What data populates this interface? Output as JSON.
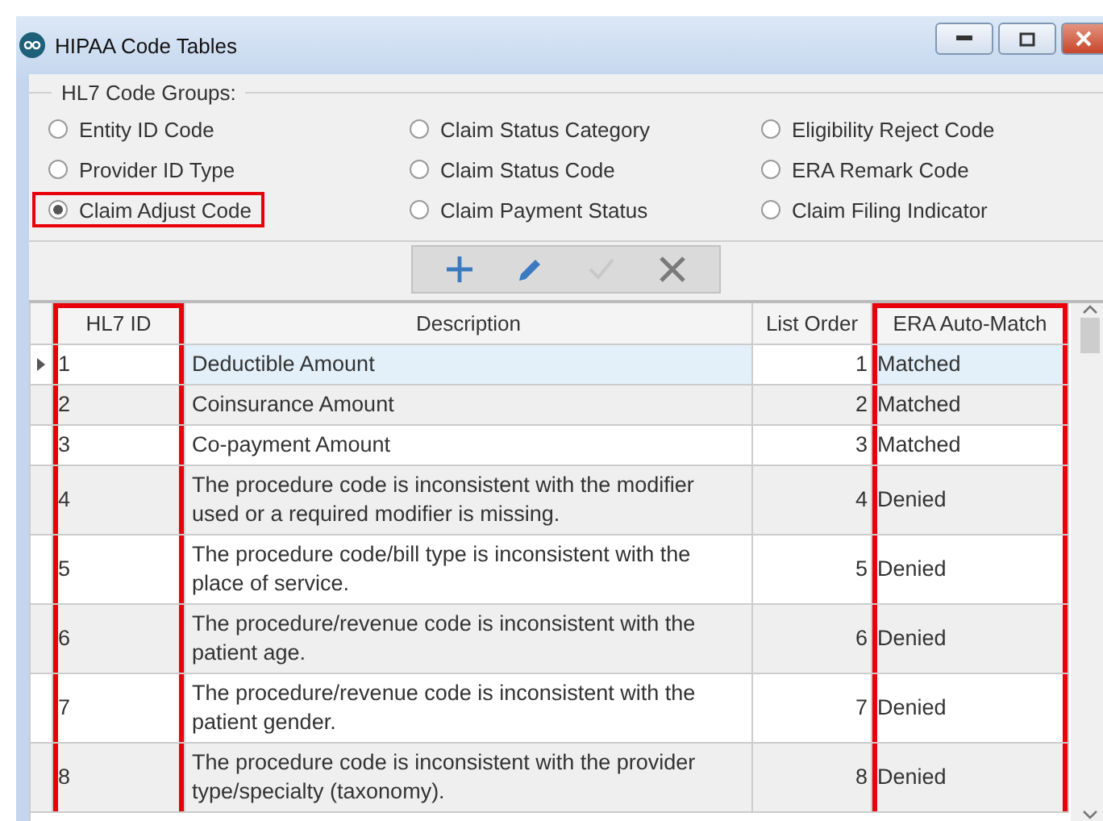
{
  "window": {
    "title": "HIPAA Code Tables"
  },
  "code_groups": {
    "title": "HL7 Code Groups:",
    "options": [
      {
        "label": "Entity ID Code",
        "selected": false,
        "highlighted": false
      },
      {
        "label": "Claim Status Category",
        "selected": false,
        "highlighted": false
      },
      {
        "label": "Eligibility Reject Code",
        "selected": false,
        "highlighted": false
      },
      {
        "label": "Provider ID Type",
        "selected": false,
        "highlighted": false
      },
      {
        "label": "Claim Status Code",
        "selected": false,
        "highlighted": false
      },
      {
        "label": "ERA Remark Code",
        "selected": false,
        "highlighted": false
      },
      {
        "label": "Claim Adjust Code",
        "selected": true,
        "highlighted": true
      },
      {
        "label": "Claim Payment Status",
        "selected": false,
        "highlighted": false
      },
      {
        "label": "Claim Filing Indicator",
        "selected": false,
        "highlighted": false
      }
    ]
  },
  "toolbar": [
    {
      "kind": "add",
      "disabled": false
    },
    {
      "kind": "edit",
      "disabled": false
    },
    {
      "kind": "confirm",
      "disabled": true
    },
    {
      "kind": "delete",
      "disabled": false
    }
  ],
  "table": {
    "columns": [
      {
        "label": "HL7 ID",
        "highlighted": true
      },
      {
        "label": "Description",
        "highlighted": false
      },
      {
        "label": "List Order",
        "highlighted": false
      },
      {
        "label": "ERA Auto-Match",
        "highlighted": true
      }
    ],
    "rows": [
      {
        "selected": true,
        "cells": [
          "1",
          "Deductible Amount",
          "1",
          "Matched"
        ]
      },
      {
        "selected": false,
        "cells": [
          "2",
          "Coinsurance Amount",
          "2",
          "Matched"
        ]
      },
      {
        "selected": false,
        "cells": [
          "3",
          "Co-payment Amount",
          "3",
          "Matched"
        ]
      },
      {
        "selected": false,
        "cells": [
          "4",
          "The procedure code is inconsistent with the modifier used or a required modifier is missing.",
          "4",
          "Denied"
        ]
      },
      {
        "selected": false,
        "cells": [
          "5",
          "The procedure code/bill type is inconsistent with the place of service.",
          "5",
          "Denied"
        ]
      },
      {
        "selected": false,
        "cells": [
          "6",
          "The procedure/revenue code is inconsistent with the patient age.",
          "6",
          "Denied"
        ]
      },
      {
        "selected": false,
        "cells": [
          "7",
          "The procedure/revenue code is inconsistent with the patient gender.",
          "7",
          "Denied"
        ]
      },
      {
        "selected": false,
        "cells": [
          "8",
          "The procedure code is inconsistent with the provider type/specialty (taxonomy).",
          "8",
          "Denied"
        ]
      }
    ]
  }
}
